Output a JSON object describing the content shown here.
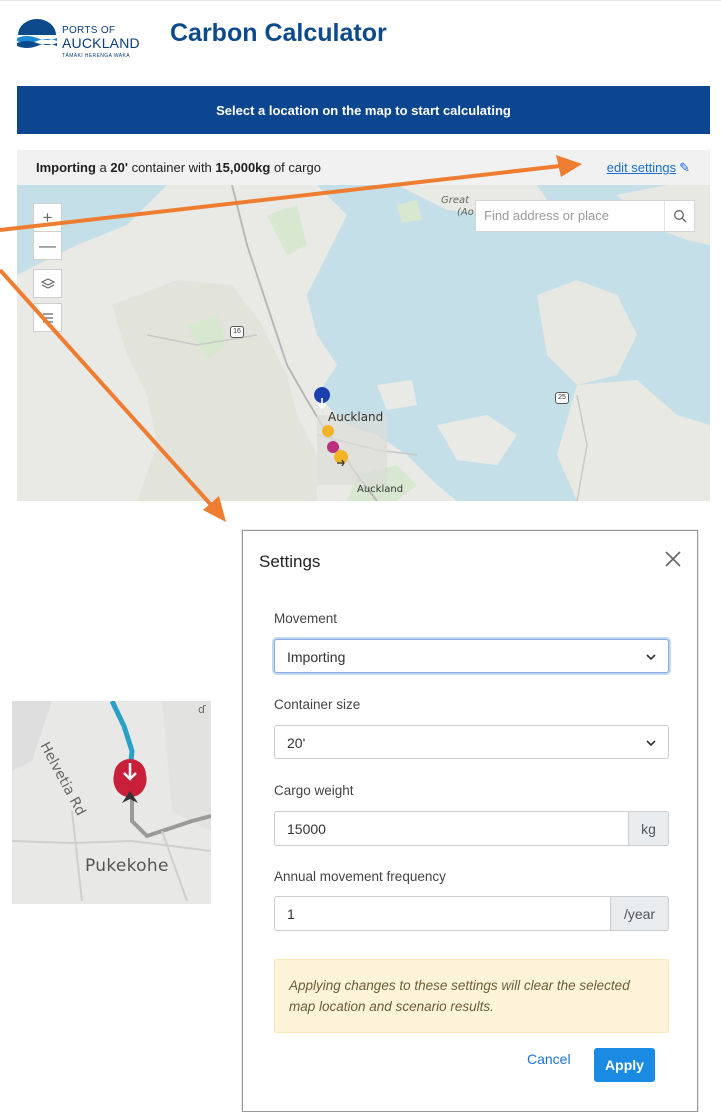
{
  "header": {
    "logo_line1": "PORTS OF",
    "logo_line2": "AUCKLAND",
    "logo_line3": "TĀMAKI HERENGA WAKA",
    "title": "Carbon Calculator"
  },
  "banner": {
    "text": "Select a location on the map to start calculating"
  },
  "summary": {
    "movement": "Importing",
    "text_a": " a ",
    "size": "20'",
    "text_b": " container with ",
    "weight": "15,000kg",
    "text_c": " of cargo",
    "edit_label": "edit settings"
  },
  "map": {
    "search_placeholder": "Find address or place",
    "zoom_in": "+",
    "zoom_out": "—",
    "labels": {
      "auckland_city": "Auckland",
      "auckland_south": "Auckland",
      "great_barrier": "Great",
      "great_barrier2": "(Ao",
      "route_16": "16",
      "route_25": "25"
    }
  },
  "inset": {
    "town": "Pukekohe",
    "road": "Helvetia Rd"
  },
  "modal": {
    "title": "Settings",
    "movement_label": "Movement",
    "movement_value": "Importing",
    "container_label": "Container size",
    "container_value": "20'",
    "weight_label": "Cargo weight",
    "weight_value": "15000",
    "weight_unit": "kg",
    "freq_label": "Annual movement frequency",
    "freq_value": "1",
    "freq_unit": "/year",
    "warning": "Applying changes to these settings will clear the selected map location and scenario results.",
    "cancel": "Cancel",
    "apply": "Apply"
  },
  "colors": {
    "brand": "#0d4690",
    "title": "#0d4a8c",
    "link": "#1a6fd0",
    "apply": "#1b8ae3",
    "arrow": "#ee7d31",
    "warning_bg": "#fdf3d9"
  }
}
